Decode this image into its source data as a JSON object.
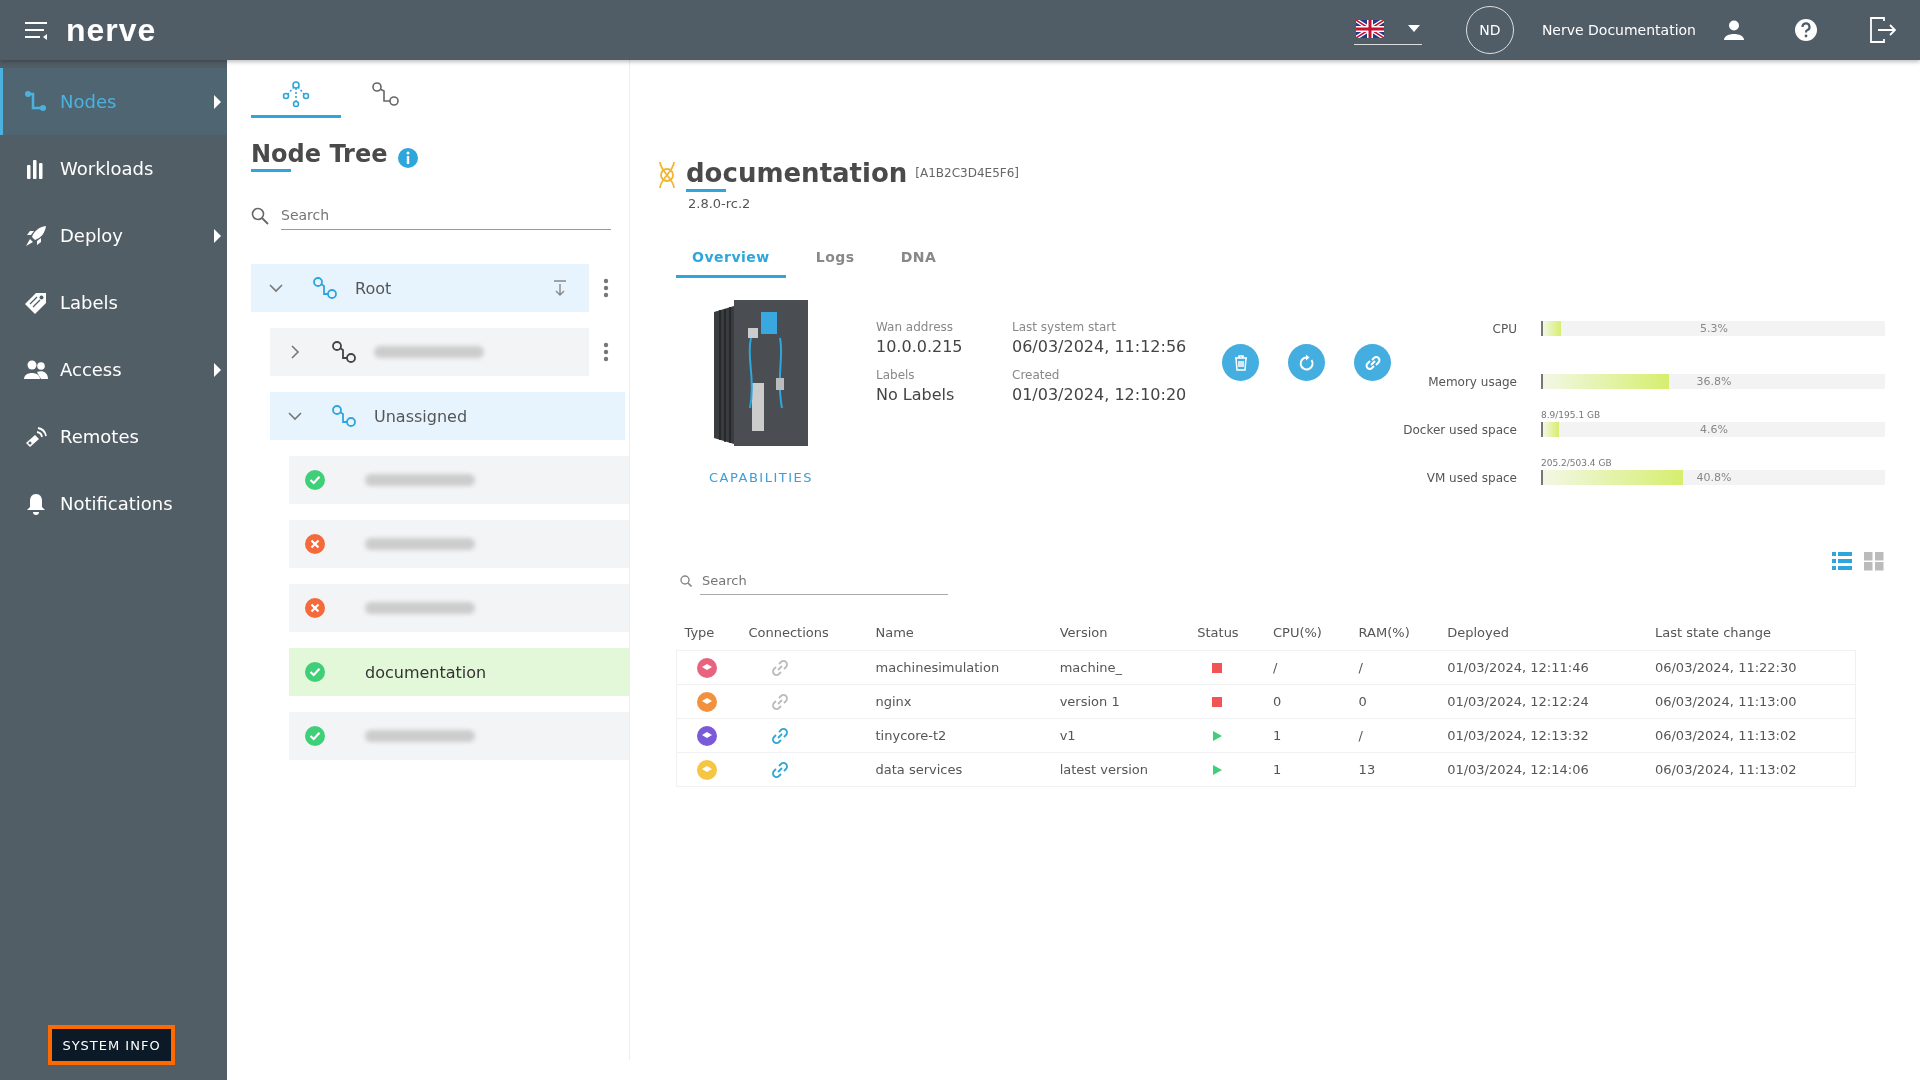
{
  "header": {
    "logo": "nerve",
    "avatar": "ND",
    "user_name": "Nerve Documentation"
  },
  "sidebar": {
    "items": [
      {
        "label": "Nodes",
        "selected": true,
        "submenu": true
      },
      {
        "label": "Workloads",
        "selected": false,
        "submenu": false
      },
      {
        "label": "Deploy",
        "selected": false,
        "submenu": true
      },
      {
        "label": "Labels",
        "selected": false,
        "submenu": false
      },
      {
        "label": "Access",
        "selected": false,
        "submenu": true
      },
      {
        "label": "Remotes",
        "selected": false,
        "submenu": false
      },
      {
        "label": "Notifications",
        "selected": false,
        "submenu": false
      }
    ],
    "system_info": "SYSTEM INFO"
  },
  "tree_panel": {
    "view_tabs": [
      {
        "selected": true
      },
      {
        "selected": false
      }
    ],
    "title": "Node Tree",
    "search": {
      "placeholder": "Search"
    },
    "tree": [
      {
        "name": "Root",
        "expanded": true,
        "menu": true,
        "children": [
          {
            "expanded": false,
            "menu": true
          },
          {
            "name": "Unassigned",
            "expanded": true,
            "menu": false,
            "children": [
              {
                "online": true,
                "selected": false
              },
              {
                "online": false,
                "selected": false
              },
              {
                "online": false,
                "selected": false
              },
              {
                "name": "documentation",
                "online": true,
                "selected": true
              },
              {
                "online": true,
                "selected": false
              }
            ]
          }
        ]
      }
    ]
  },
  "node": {
    "name": "documentation",
    "serial": "[A1B2C3D4E5F6]",
    "version": "2.8.0-rc.2",
    "tabs": [
      {
        "label": "Overview",
        "selected": true
      },
      {
        "label": "Logs",
        "selected": false
      },
      {
        "label": "DNA",
        "selected": false
      }
    ],
    "capabilities": "CAPABILITIES",
    "info": [
      {
        "label": "Wan address",
        "value": "10.0.0.215"
      },
      {
        "label": "Last system start",
        "value": "06/03/2024, 11:12:56"
      },
      {
        "label": "Labels",
        "value": "No Labels"
      },
      {
        "label": "Created",
        "value": "01/03/2024, 12:10:20"
      }
    ],
    "meters": [
      {
        "label": "CPU",
        "level": 0.053,
        "reading": "5.3%"
      },
      {
        "label": "Memory usage",
        "level": 0.368,
        "reading": "36.8%"
      },
      {
        "label": "Docker used space",
        "level": 0.046,
        "reading": "4.6%",
        "detail": "8.9/195.1 GB"
      },
      {
        "label": "VM used space",
        "level": 0.408,
        "reading": "40.8%",
        "detail": "205.2/503.4 GB"
      }
    ]
  },
  "workloads": {
    "search": {
      "placeholder": "Search"
    },
    "view": [
      {
        "selected": true
      },
      {
        "selected": false
      }
    ],
    "columns": [
      "Type",
      "Connections",
      "Name",
      "Version",
      "Status",
      "CPU(%)",
      "RAM(%)",
      "Deployed",
      "Last state change"
    ],
    "rows": [
      {
        "color": "#e8637e",
        "connected": false,
        "name": "machinesimulation",
        "version": "machine_",
        "running": false,
        "cpu": "/",
        "ram": "/",
        "deployed": "01/03/2024, 12:11:46",
        "changed": "06/03/2024, 11:22:30"
      },
      {
        "color": "#f2913d",
        "connected": false,
        "name": "nginx",
        "version": "version 1",
        "running": false,
        "cpu": "0",
        "ram": "0",
        "deployed": "01/03/2024, 12:12:24",
        "changed": "06/03/2024, 11:13:00"
      },
      {
        "color": "#7b5ad8",
        "connected": true,
        "name": "tinycore-t2",
        "version": "v1",
        "running": true,
        "cpu": "1",
        "ram": "/",
        "deployed": "01/03/2024, 12:13:32",
        "changed": "06/03/2024, 11:13:02"
      },
      {
        "color": "#f5c544",
        "connected": true,
        "name": "data services",
        "version": "latest version",
        "running": true,
        "cpu": "1",
        "ram": "13",
        "deployed": "01/03/2024, 12:14:06",
        "changed": "06/03/2024, 11:13:02"
      }
    ]
  }
}
